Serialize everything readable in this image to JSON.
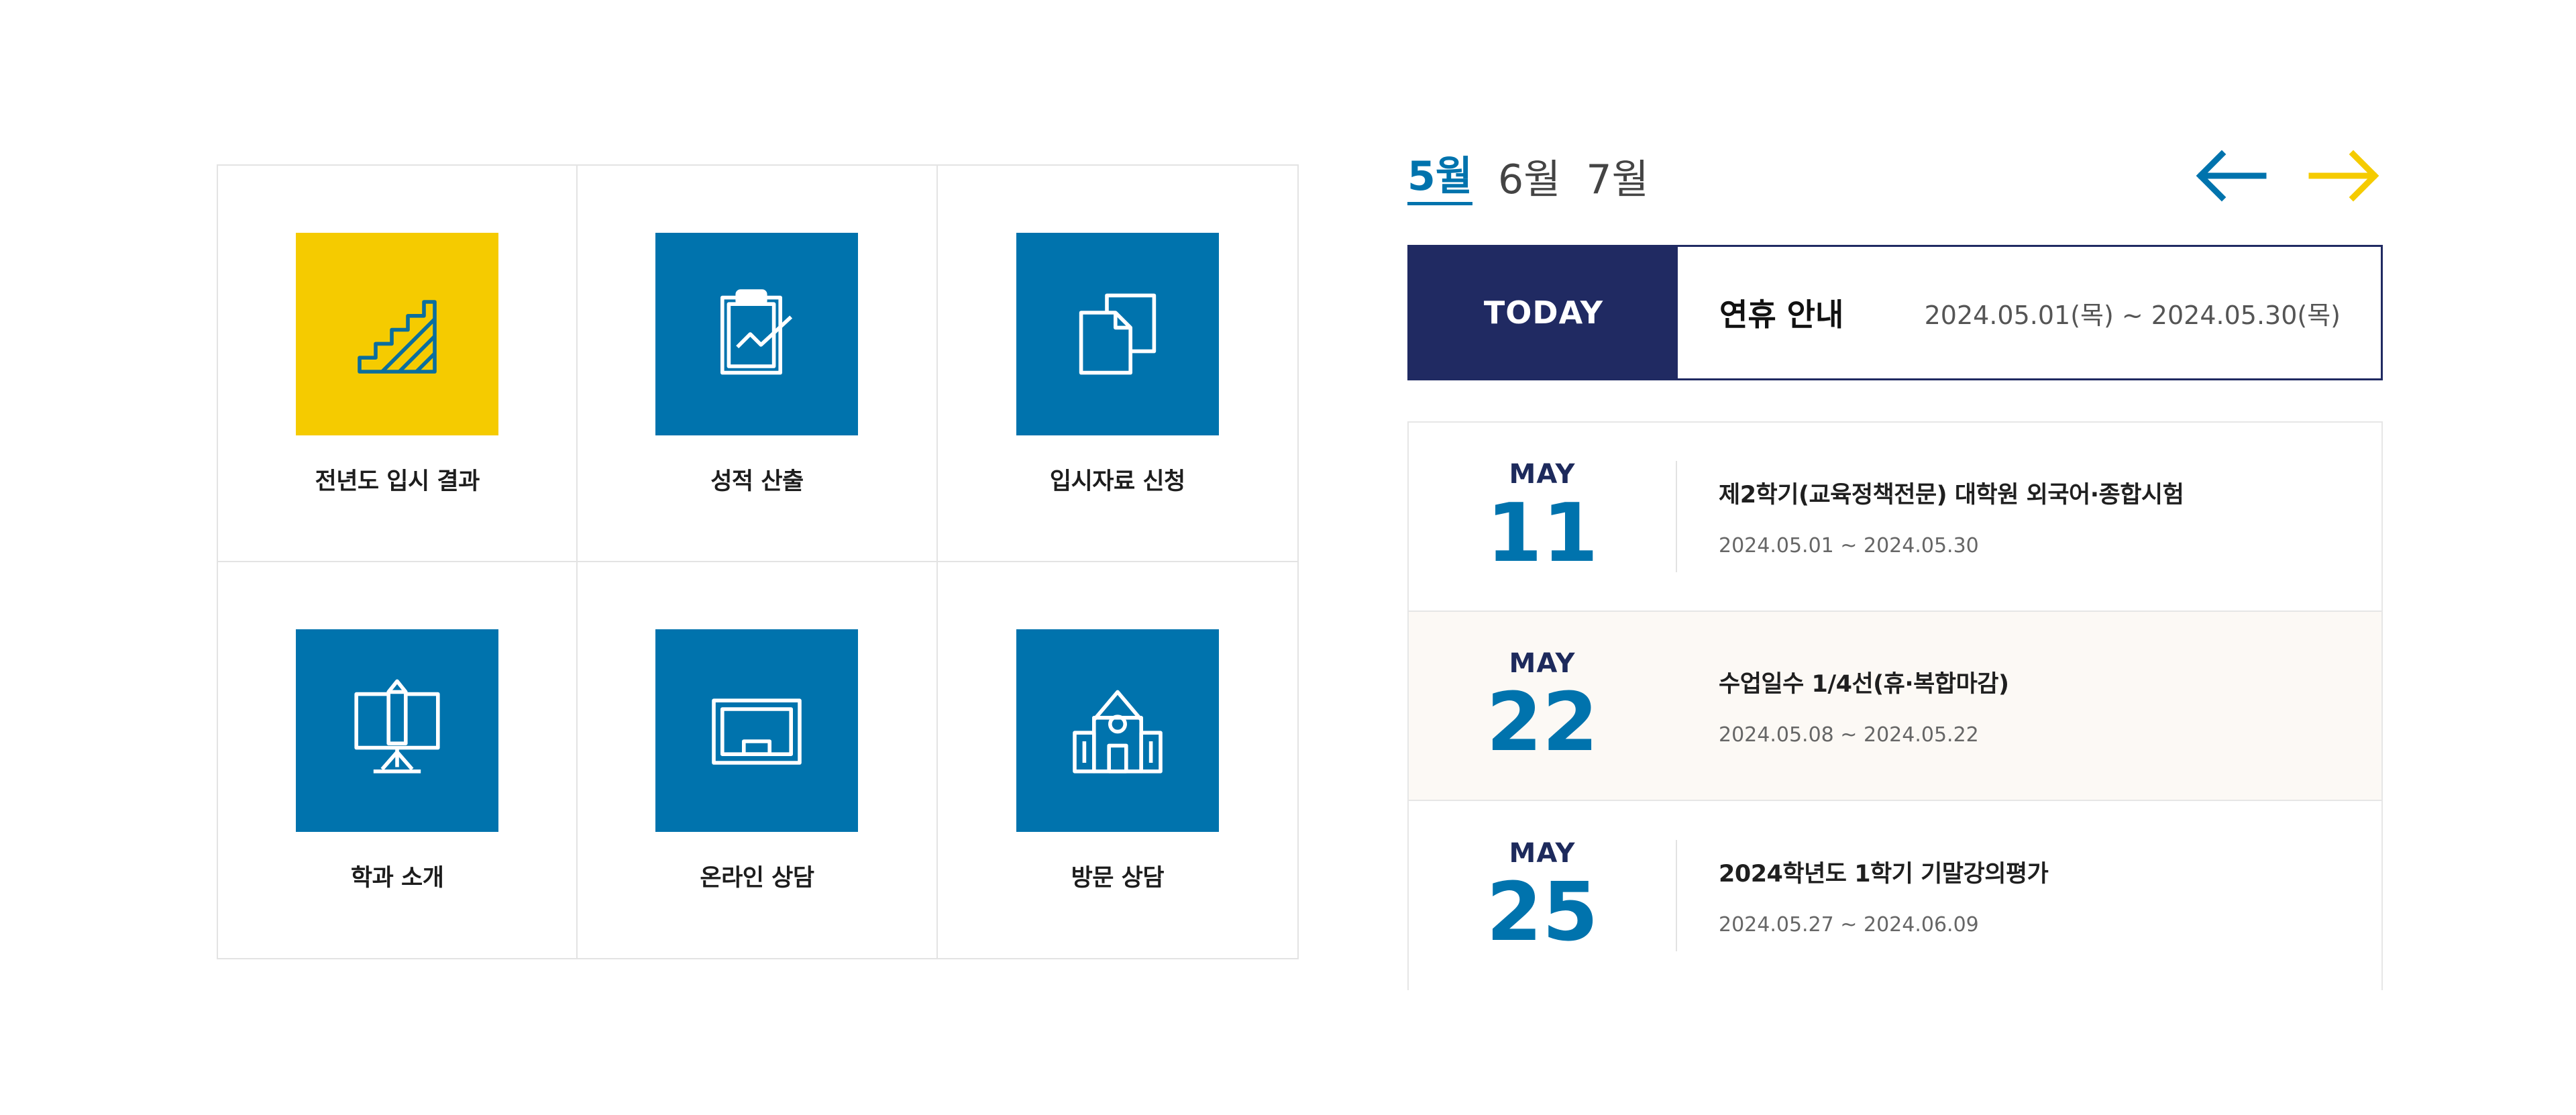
{
  "quick_menu": {
    "items": [
      {
        "label": "전년도 입시 결과",
        "icon": "stairs-icon",
        "color": "#f5cb00"
      },
      {
        "label": "성적 산출",
        "icon": "clipboard-chart-icon",
        "color": "#0073ad"
      },
      {
        "label": "입시자료 신청",
        "icon": "documents-icon",
        "color": "#0073ad"
      },
      {
        "label": "학과 소개",
        "icon": "easel-pencil-icon",
        "color": "#0073ad"
      },
      {
        "label": "온라인 상담",
        "icon": "monitor-icon",
        "color": "#0073ad"
      },
      {
        "label": "방문 상담",
        "icon": "school-building-icon",
        "color": "#0073ad"
      }
    ]
  },
  "calendar": {
    "months": [
      "5월",
      "6월",
      "7월"
    ],
    "active_month": "5월",
    "prev_arrow_color": "#0073ad",
    "next_arrow_color": "#f5cb00",
    "today": {
      "tag": "TODAY",
      "title": "연휴 안내",
      "range": "2024.05.01(목) ~ 2024.05.30(목)"
    },
    "events": [
      {
        "month": "MAY",
        "day": "11",
        "title": "제2학기(교육정책전문) 대학원 외국어·종합시험",
        "range": "2024.05.01 ~ 2024.05.30"
      },
      {
        "month": "MAY",
        "day": "22",
        "title": "수업일수 1/4선(휴·복합마감)",
        "range": "2024.05.08 ~ 2024.05.22"
      },
      {
        "month": "MAY",
        "day": "25",
        "title": "2024학년도 1학기 기말강의평가",
        "range": "2024.05.27 ~ 2024.06.09"
      }
    ]
  }
}
